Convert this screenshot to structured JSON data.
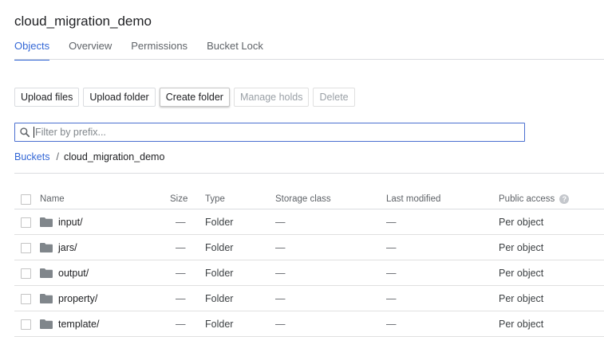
{
  "header": {
    "title": "cloud_migration_demo"
  },
  "tabs": [
    {
      "label": "Objects",
      "active": true
    },
    {
      "label": "Overview"
    },
    {
      "label": "Permissions"
    },
    {
      "label": "Bucket Lock"
    }
  ],
  "toolbar": {
    "upload_files": "Upload files",
    "upload_folder": "Upload folder",
    "create_folder": "Create folder",
    "manage_holds": "Manage holds",
    "delete": "Delete"
  },
  "filter": {
    "placeholder": "Filter by prefix..."
  },
  "breadcrumb": {
    "root": "Buckets",
    "separator": "/",
    "current": "cloud_migration_demo"
  },
  "table": {
    "columns": [
      "Name",
      "Size",
      "Type",
      "Storage class",
      "Last modified",
      "Public access"
    ],
    "rows": [
      {
        "name": "input/",
        "size": "—",
        "type": "Folder",
        "storage_class": "—",
        "last_modified": "—",
        "public_access": "Per object"
      },
      {
        "name": "jars/",
        "size": "—",
        "type": "Folder",
        "storage_class": "—",
        "last_modified": "—",
        "public_access": "Per object"
      },
      {
        "name": "output/",
        "size": "—",
        "type": "Folder",
        "storage_class": "—",
        "last_modified": "—",
        "public_access": "Per object"
      },
      {
        "name": "property/",
        "size": "—",
        "type": "Folder",
        "storage_class": "—",
        "last_modified": "—",
        "public_access": "Per object"
      },
      {
        "name": "template/",
        "size": "—",
        "type": "Folder",
        "storage_class": "—",
        "last_modified": "—",
        "public_access": "Per object"
      }
    ]
  },
  "colors": {
    "accent": "#3367d6",
    "folder_icon": "#80868b"
  },
  "icons": {
    "search": "search-icon",
    "folder": "folder-icon",
    "help": "help-icon"
  }
}
